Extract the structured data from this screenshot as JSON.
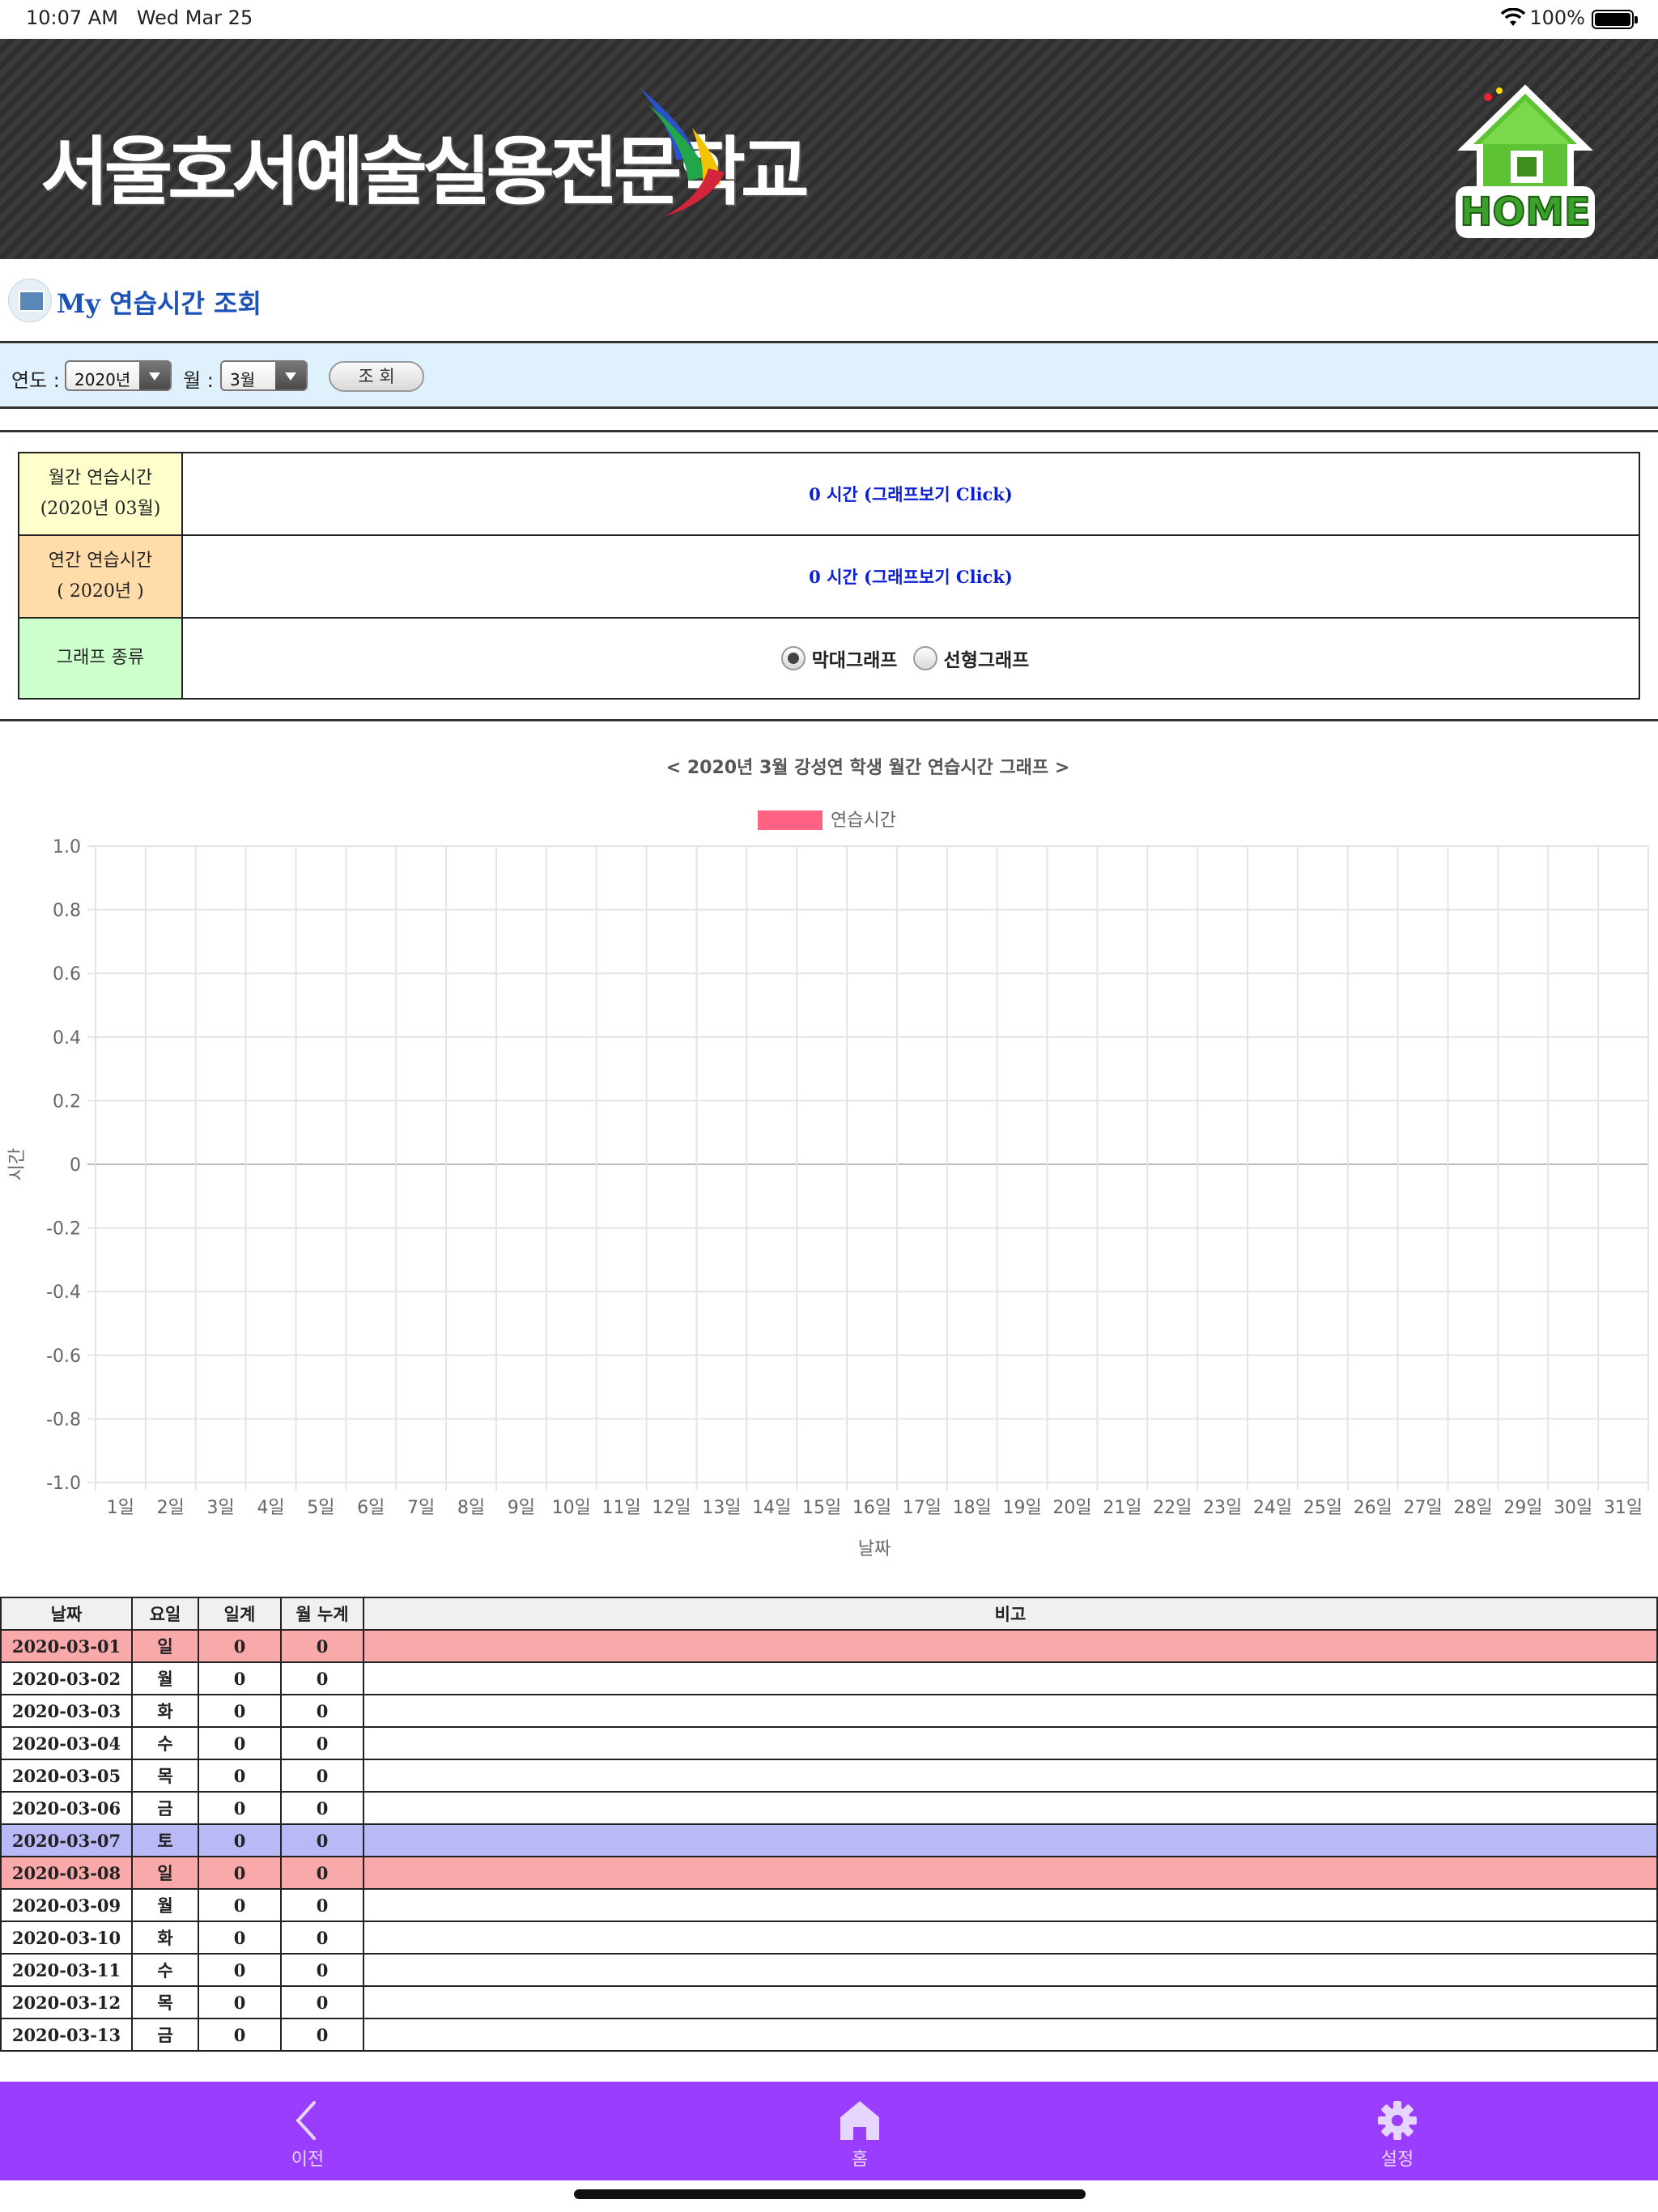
{
  "status_bar": {
    "time": "10:07 AM",
    "date": "Wed Mar 25",
    "battery": "100%"
  },
  "header": {
    "school_name": "서울호서예술실용전문학교",
    "home_label": "HOME"
  },
  "page": {
    "title": "My 연습시간 조회"
  },
  "filter": {
    "year_label": "연도 :",
    "year_value": "2020년",
    "month_label": "월 :",
    "month_value": "3월",
    "search_button": "조 회"
  },
  "info": {
    "monthly_label_1": "월간 연습시간",
    "monthly_label_2": "(2020년 03월)",
    "monthly_value": "0 시간 (그래프보기 Click)",
    "yearly_label_1": "연간 연습시간",
    "yearly_label_2": "( 2020년 )",
    "yearly_value": "0 시간 (그래프보기 Click)",
    "graph_type_label": "그래프 종류",
    "graph_bar": "막대그래프",
    "graph_line": "선형그래프",
    "selected": "막대그래프",
    "colors": {
      "monthly": "#ffffcc",
      "yearly": "#ffdcaa",
      "graph_type": "#ccffcc"
    }
  },
  "chart_data": {
    "type": "bar",
    "title": "< 2020년 3월 강성연 학생 월간 연습시간 그래프 >",
    "xlabel": "날짜",
    "ylabel": "시간",
    "ylim": [
      -1.0,
      1.0
    ],
    "yticks": [
      "1.0",
      "0.8",
      "0.6",
      "0.4",
      "0.2",
      "0",
      "-0.2",
      "-0.4",
      "-0.6",
      "-0.8",
      "-1.0"
    ],
    "categories": [
      "1일",
      "2일",
      "3일",
      "4일",
      "5일",
      "6일",
      "7일",
      "8일",
      "9일",
      "10일",
      "11일",
      "12일",
      "13일",
      "14일",
      "15일",
      "16일",
      "17일",
      "18일",
      "19일",
      "20일",
      "21일",
      "22일",
      "23일",
      "24일",
      "25일",
      "26일",
      "27일",
      "28일",
      "29일",
      "30일",
      "31일"
    ],
    "series": [
      {
        "name": "연습시간",
        "color": "#ff6384",
        "values": [
          0,
          0,
          0,
          0,
          0,
          0,
          0,
          0,
          0,
          0,
          0,
          0,
          0,
          0,
          0,
          0,
          0,
          0,
          0,
          0,
          0,
          0,
          0,
          0,
          0,
          0,
          0,
          0,
          0,
          0,
          0
        ]
      }
    ],
    "grid": true,
    "legend": "top-center"
  },
  "table": {
    "headers": [
      "날짜",
      "요일",
      "일계",
      "월 누계",
      "비고"
    ],
    "rows": [
      {
        "date": "2020-03-01",
        "day": "일",
        "daily": "0",
        "cumulative": "0",
        "note": "",
        "type": "sun"
      },
      {
        "date": "2020-03-02",
        "day": "월",
        "daily": "0",
        "cumulative": "0",
        "note": "",
        "type": ""
      },
      {
        "date": "2020-03-03",
        "day": "화",
        "daily": "0",
        "cumulative": "0",
        "note": "",
        "type": ""
      },
      {
        "date": "2020-03-04",
        "day": "수",
        "daily": "0",
        "cumulative": "0",
        "note": "",
        "type": ""
      },
      {
        "date": "2020-03-05",
        "day": "목",
        "daily": "0",
        "cumulative": "0",
        "note": "",
        "type": ""
      },
      {
        "date": "2020-03-06",
        "day": "금",
        "daily": "0",
        "cumulative": "0",
        "note": "",
        "type": ""
      },
      {
        "date": "2020-03-07",
        "day": "토",
        "daily": "0",
        "cumulative": "0",
        "note": "",
        "type": "sat"
      },
      {
        "date": "2020-03-08",
        "day": "일",
        "daily": "0",
        "cumulative": "0",
        "note": "",
        "type": "sun"
      },
      {
        "date": "2020-03-09",
        "day": "월",
        "daily": "0",
        "cumulative": "0",
        "note": "",
        "type": ""
      },
      {
        "date": "2020-03-10",
        "day": "화",
        "daily": "0",
        "cumulative": "0",
        "note": "",
        "type": ""
      },
      {
        "date": "2020-03-11",
        "day": "수",
        "daily": "0",
        "cumulative": "0",
        "note": "",
        "type": ""
      },
      {
        "date": "2020-03-12",
        "day": "목",
        "daily": "0",
        "cumulative": "0",
        "note": "",
        "type": ""
      },
      {
        "date": "2020-03-13",
        "day": "금",
        "daily": "0",
        "cumulative": "0",
        "note": "",
        "type": ""
      }
    ]
  },
  "tabbar": {
    "prev": "이전",
    "home": "홈",
    "settings": "설정",
    "icons": {
      "prev": "chevron-left-icon",
      "home": "home-icon",
      "settings": "gear-icon"
    },
    "background": "#9b3dff"
  }
}
